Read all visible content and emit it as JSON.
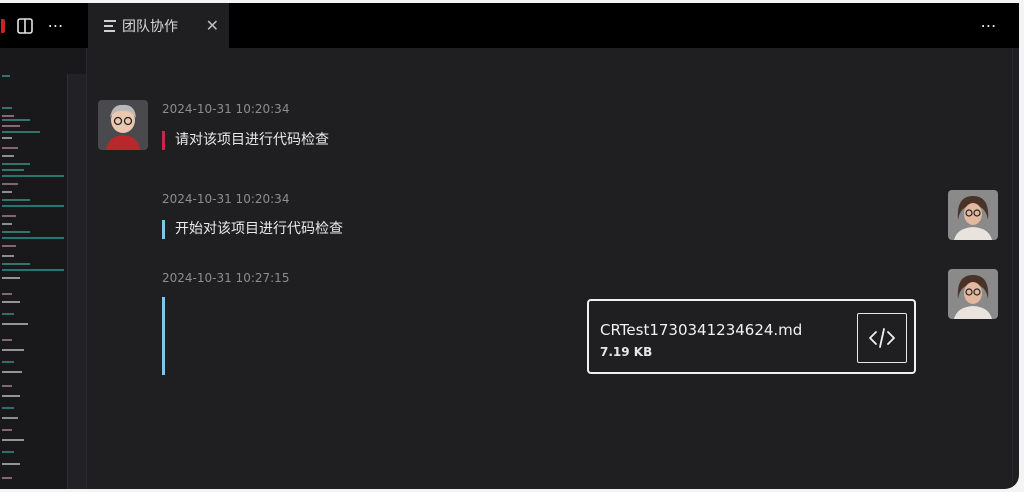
{
  "tab": {
    "icon": "document-icon",
    "title": "团队协作",
    "close_glyph": "✕"
  },
  "topbar": {
    "more_glyph": "⋯",
    "split_icon": "split-view-icon"
  },
  "messages": [
    {
      "sender": "user",
      "timestamp": "2024-10-31 10:20:34",
      "text": "请对该项目进行代码检查",
      "accent": "#c8264a"
    },
    {
      "sender": "assistant",
      "timestamp": "2024-10-31 10:20:34",
      "text": "开始对该项目进行代码检查",
      "accent": "#7fc7e3"
    },
    {
      "sender": "assistant",
      "timestamp": "2024-10-31 10:27:15",
      "text": "",
      "accent": "#7fc7e3",
      "attachment": {
        "file_name": "CRTest1730341234624.md",
        "file_size": "7.19 KB",
        "icon": "code-icon"
      }
    }
  ],
  "colors": {
    "background": "#1f1e21",
    "titlebar": "#000000",
    "text": "#e9e9e9",
    "timestamp": "#8d8d8d"
  }
}
